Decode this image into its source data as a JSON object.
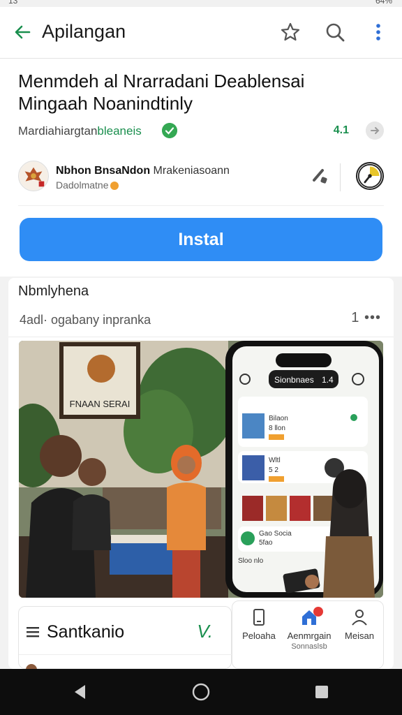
{
  "status_bar": {
    "left_text": "13",
    "right_text": "64%"
  },
  "app_bar": {
    "title": "Apilangan",
    "icons": [
      "back-arrow-icon",
      "star-icon",
      "search-icon",
      "more-vert-icon"
    ]
  },
  "app": {
    "title_line1": "Menmdeh al Nrarradani Deablensai",
    "title_line2": "Mingaah Noanindtinly",
    "developer_prefix": "Mardiahiargtan",
    "developer_highlight": "bleaneis",
    "rating_text": "4.1",
    "publisher_name_bold": "Nbhon BnsaNdon",
    "publisher_name_rest": " Mrakeniasoann",
    "publisher_sub": "Dadolmatne",
    "install_label": "Instal"
  },
  "section": {
    "title": "Nbmlyhena",
    "subtitle": "4adl· ogabany inpranka",
    "more_count": "1",
    "more_icon": "•••"
  },
  "screenshot": {
    "sign_text": "FNAAN SERAI",
    "phone_header": "Sionbnaes",
    "phone_header_badge": "1.4",
    "phone_rows": [
      {
        "title": "Bilaon",
        "sub": "8 llon"
      },
      {
        "title": "Wltl",
        "sub": "5 2"
      },
      {
        "title": "Gao Socia",
        "sub": "5fao"
      },
      {
        "title": "Sloo nlo"
      }
    ]
  },
  "bottom_card": {
    "title": "Santkanio",
    "check": "V."
  },
  "bottom_nav": [
    {
      "label": "Peloaha",
      "icon": "phone-icon"
    },
    {
      "label": "Aenmrgain",
      "sub": "Sonnaslsb",
      "icon": "home-icon"
    },
    {
      "label": "Meisan",
      "icon": "person-icon"
    }
  ],
  "colors": {
    "accent": "#2f8df5",
    "green": "#1a8f4e",
    "nav_bar": "#0d0d0d"
  }
}
